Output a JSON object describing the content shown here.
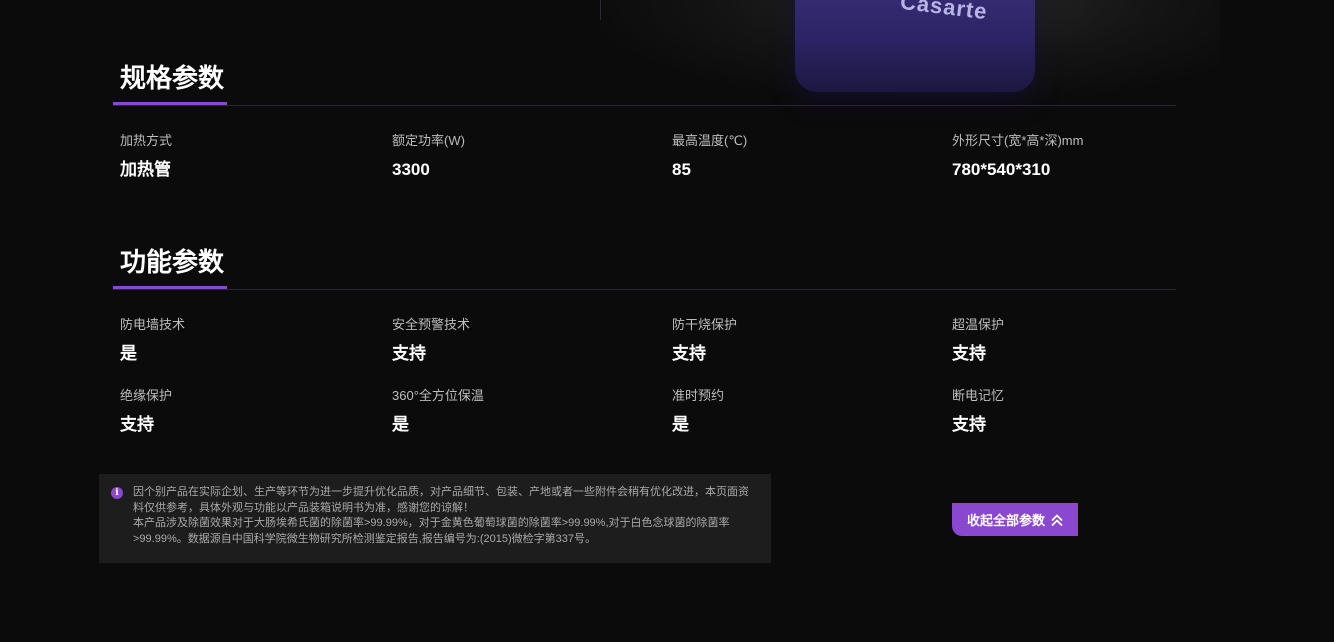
{
  "hero": {
    "brand_text": "Casarte"
  },
  "spec_section": {
    "title": "规格参数",
    "items": [
      {
        "label": "加热方式",
        "value": "加热管"
      },
      {
        "label": "额定功率(W)",
        "value": "3300"
      },
      {
        "label": "最高温度(℃)",
        "value": "85"
      },
      {
        "label": "外形尺寸(宽*高*深)mm",
        "value": "780*540*310"
      }
    ]
  },
  "function_section": {
    "title": "功能参数",
    "items": [
      {
        "label": "防电墙技术",
        "value": "是"
      },
      {
        "label": "安全预警技术",
        "value": "支持"
      },
      {
        "label": "防干烧保护",
        "value": "支持"
      },
      {
        "label": "超温保护",
        "value": "支持"
      },
      {
        "label": "绝缘保护",
        "value": "支持"
      },
      {
        "label": "360°全方位保温",
        "value": "是"
      },
      {
        "label": "准时预约",
        "value": "是"
      },
      {
        "label": "断电记忆",
        "value": "支持"
      }
    ]
  },
  "notice": {
    "icon": "info-icon",
    "line1": "因个别产品在实际企划、生产等环节为进一步提升优化品质，对产品细节、包装、产地或者一些附件会稍有优化改进，本页面资料仅供参考，具体外观与功能以产品装箱说明书为准，感谢您的谅解！",
    "line2": "本产品涉及除菌效果对于大肠埃希氏菌的除菌率>99.99%，对于金黄色葡萄球菌的除菌率>99.99%,对于白色念球菌的除菌率>99.99%。数据源自中国科学院微生物研究所检测鉴定报告,报告编号为:(2015)微检字第337号。"
  },
  "collapse_button": {
    "label": "收起全部参数",
    "icon": "double-chevron-up-icon"
  },
  "colors": {
    "accent": "#8a47cf",
    "background": "#0c0b0c",
    "notice_bg": "#1e1d1e"
  }
}
